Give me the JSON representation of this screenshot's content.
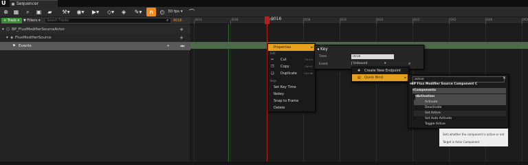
{
  "window": {
    "tab_title": "Sequencer",
    "logo": "U"
  },
  "toolbar": {
    "fps": "30 fps ▾",
    "flux_icon": "∩"
  },
  "tracks": {
    "add_label": "+ Track ▾",
    "filters_label": "▼ Filters ▾",
    "search_placeholder": "Search Tracks",
    "current_frame": "0016"
  },
  "outliner": {
    "items": [
      {
        "label": "BP_FluxModifierSourceActor"
      },
      {
        "label": "FluxModifierSource"
      },
      {
        "label": "Events"
      }
    ]
  },
  "timeline": {
    "ticks": [
      "-0016",
      "-0008",
      "0000",
      "0008",
      "0016",
      "0024",
      "0032",
      "0040",
      "0048",
      "0056",
      "0064",
      "0072"
    ],
    "playhead_label": "0016"
  },
  "context_menu": {
    "properties_label": "Properties",
    "edit_header": "Edit",
    "cut": "Cut",
    "cut_short": "Ctrl+X",
    "copy": "Copy",
    "copy_short": "Ctrl+C",
    "duplicate": "Duplicate",
    "duplicate_short": "Ctrl+W",
    "keys_header": "Keys",
    "set_key_time": "Set Key Time",
    "rekey": "Rekey",
    "snap_to_frame": "Snap to Frame",
    "delete": "Delete"
  },
  "key_panel": {
    "title": "Key",
    "time_label": "Time",
    "time_value": "0016",
    "event_label": "Event",
    "event_value": "Unbound"
  },
  "endpoint_menu": {
    "create_new": "Create New Endpoint",
    "quick_bind": "Quick Bind"
  },
  "quickbind_menu": {
    "search_value": "active",
    "header": "BP Flux Modifier Source Component C",
    "components": "Components",
    "activation": "Activation",
    "items": [
      "Activate",
      "Deactivate",
      "Set Active",
      "Set Auto Activate",
      "Toggle Active"
    ]
  },
  "tooltip": {
    "line1": "Sets whether the component is active or not",
    "line2": "Target is Actor Component"
  },
  "colors": {
    "accent": "#e8a11c",
    "track_green": "#3c8c3c",
    "playhead": "#b82020"
  }
}
